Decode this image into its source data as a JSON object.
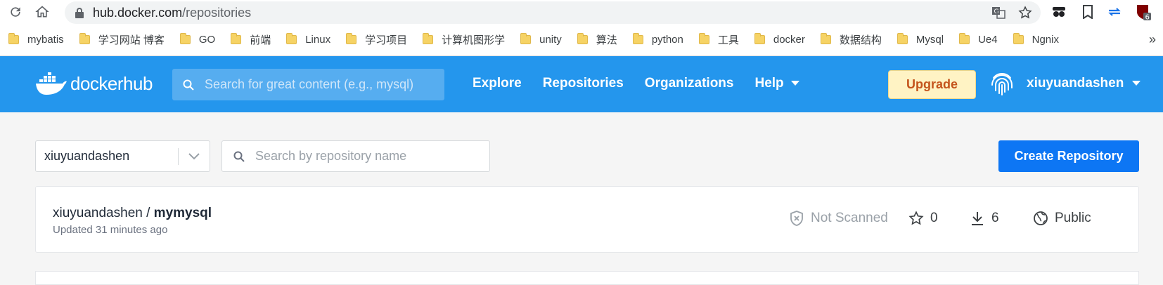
{
  "browser": {
    "url_host": "hub.docker.com",
    "url_path": "/repositories",
    "ext_badge": "6",
    "bookmarks": [
      "mybatis",
      "学习网站 博客",
      "GO",
      "前端",
      "Linux",
      "学习项目",
      "计算机图形学",
      "unity",
      "算法",
      "python",
      "工具",
      "docker",
      "数据结构",
      "Mysql",
      "Ue4",
      "Ngnix"
    ],
    "more": "»"
  },
  "header": {
    "logo_text": "dockerhub",
    "search_placeholder": "Search for great content (e.g., mysql)",
    "nav": {
      "explore": "Explore",
      "repositories": "Repositories",
      "organizations": "Organizations",
      "help": "Help"
    },
    "upgrade": "Upgrade",
    "username": "xiuyuandashen"
  },
  "filters": {
    "namespace": "xiuyuandashen",
    "repo_search_placeholder": "Search by repository name",
    "create_button": "Create Repository"
  },
  "repos": [
    {
      "namespace": "xiuyuandashen",
      "separator": " / ",
      "name": "mymysql",
      "updated": "Updated 31 minutes ago",
      "scan_status": "Not Scanned",
      "stars": "0",
      "pulls": "6",
      "visibility": "Public"
    }
  ],
  "colors": {
    "brand": "#2496ed",
    "primary": "#0d76f4",
    "upgrade_bg": "#fff3c4",
    "upgrade_text": "#c4541c"
  }
}
